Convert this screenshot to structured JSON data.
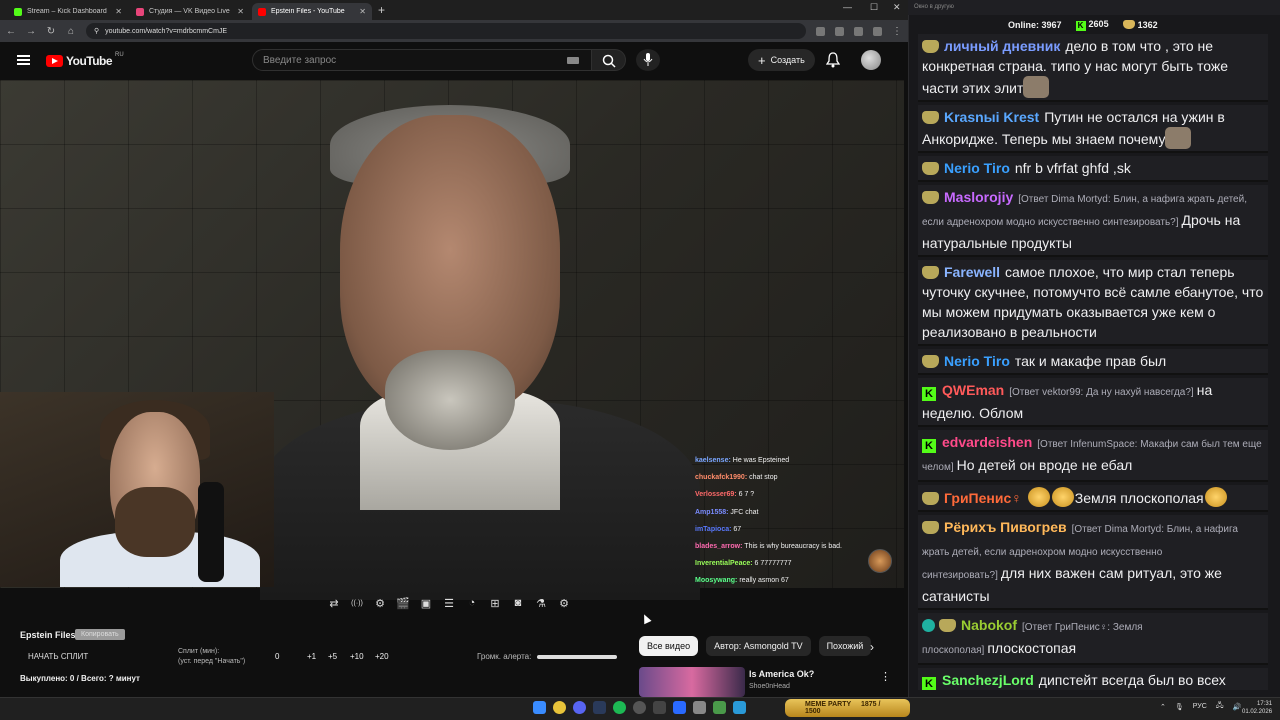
{
  "browser": {
    "tabs": [
      {
        "label": "Stream – Kick Dashboard",
        "color": "#53fc18"
      },
      {
        "label": "Студия — VK Видео Live",
        "color": "#e8457a"
      },
      {
        "label": "Epstein Files - YouTube",
        "color": "#ff0000"
      }
    ],
    "url": "youtube.com/watch?v=mdrbcmmCmJE"
  },
  "youtube": {
    "logo": "YouTube",
    "region": "RU",
    "search_placeholder": "Введите запрос",
    "create": "Создать"
  },
  "video_chat": [
    {
      "name": "kaelsense:",
      "text": "He was Epsteined",
      "color": "#7aa6ff"
    },
    {
      "name": "chuckafck1990:",
      "text": "chat stop",
      "color": "#ff8c6a"
    },
    {
      "name": "Verlosser69:",
      "text": "6 7 ?",
      "color": "#ff6a6a"
    },
    {
      "name": "Amp1558:",
      "text": "JFC chat",
      "color": "#7a8cff"
    },
    {
      "name": "imTapioca:",
      "text": "67",
      "color": "#5a7aff"
    },
    {
      "name": "blades_arrow:",
      "text": "This is why bureaucracy is bad.",
      "color": "#ff6ab0"
    },
    {
      "name": "InverentialPeace:",
      "text": "6 77777777",
      "color": "#9aff5a"
    },
    {
      "name": "Moosywang:",
      "text": "really asmon 67",
      "color": "#5aff8a"
    }
  ],
  "controls": {
    "icons": [
      "cycle-icon",
      "broadcast-icon",
      "webcam-settings-icon",
      "clapperboard-icon",
      "picture-icon",
      "split-icon",
      "speedometer-icon",
      "add-clip-icon",
      "camera-icon",
      "flask-icon",
      "gear-icon"
    ]
  },
  "below": {
    "title": "Epstein Files",
    "copy": "Копировать",
    "start_split": "НАЧАТЬ СПЛИТ",
    "split_label_1": "Сплит (мин):",
    "split_label_2": "(уст. перед \"Начать\")",
    "split_value": "0",
    "increments": [
      "+1",
      "+5",
      "+10",
      "+20"
    ],
    "bought": "Выкуплено: 0 / Всего: ? минут",
    "volume_label": "Громк. алерта:",
    "volume_level": 1.0
  },
  "chips": [
    "Все видео",
    "Автор: Asmongold TV",
    "Похожий"
  ],
  "recommendation": {
    "title": "Is America Ok?",
    "channel": "Shoe0nHead"
  },
  "chat": {
    "window_title": "Окно в другую",
    "online_label": "Online:",
    "online": "3967",
    "kick_count": "2605",
    "crown_count": "1362",
    "messages": [
      {
        "badge": "crown",
        "user": "личный дневник",
        "color": "#7a9cff",
        "reply": "",
        "text": "дело в том что , это не конкретная страна. типо у нас могут быть тоже части этих элит",
        "emote": "cat"
      },
      {
        "badge": "crown",
        "user": "Krasnыі Krest",
        "color": "#5aa8ff",
        "reply": "",
        "text": "Путин не остался на ужин в Анкоридже. Теперь мы знаем почему",
        "emote": "cat"
      },
      {
        "badge": "crown",
        "user": "Nerio Tiro",
        "color": "#3aa0ff",
        "reply": "",
        "text": "nfr b vfrfat ghfd ,sk",
        "emote": ""
      },
      {
        "badge": "crown",
        "user": "Maslorojiy",
        "color": "#c86aff",
        "reply": "[Ответ Dima Mortyd: Блин, а нафига жрать детей, если адренохром модно искусственно синтезировать?]",
        "text": "Дрочь на натуральные продукты",
        "emote": ""
      },
      {
        "badge": "crown",
        "user": "Farewell",
        "color": "#8ab4ff",
        "reply": "",
        "text": "самое плохое, что мир стал теперь чуточку скучнее, потомучто всё самле ебанутое, что мы можем придумать оказывается уже кем о реализовано в реальности",
        "emote": ""
      },
      {
        "badge": "crown",
        "user": "Nerio Tiro",
        "color": "#3aa0ff",
        "reply": "",
        "text": "так и макафе прав был",
        "emote": ""
      },
      {
        "badge": "kick",
        "user": "QWEman",
        "color": "#ff5a5a",
        "reply": "[Ответ vektor99: Да ну нахуй навсегда?]",
        "text": "на неделю. Облом",
        "emote": ""
      },
      {
        "badge": "kick",
        "user": "edvardeishen",
        "color": "#ff4a8a",
        "reply": "[Ответ InfenumSpace: Макафи сам был тем еще челом]",
        "text": "Но детей он вроде не ебал",
        "emote": ""
      },
      {
        "badge": "crown",
        "user": "ГриПенис♀",
        "color": "#ff6a3a",
        "reply": "",
        "text": "Земля плоскополая",
        "emote": "smile"
      },
      {
        "badge": "crown",
        "user": "Рёрихъ Пивогрев",
        "color": "#ffb85a",
        "reply": "[Ответ Dima Mortyd: Блин, а нафига жрать детей, если адренохром модно искусственно синтезировать?]",
        "text": "для них важен сам ритуал, это же сатанисты",
        "emote": ""
      },
      {
        "badge": "verified",
        "user": "Nabokof",
        "color": "#9acd32",
        "reply": "[Ответ ГриПенис♀: Земля плоскополая]",
        "text": "плоскостопая",
        "emote": ""
      },
      {
        "badge": "kick",
        "user": "SanchezjLord",
        "color": "#6aff6a",
        "reply": "",
        "text": "дипстейт всегда был во всех крупных государствах",
        "emote": ""
      }
    ]
  },
  "taskbar": {
    "meme_party": "MEME PARTY",
    "meme_progress": "1875 / 1500",
    "lang": "РУС",
    "time": "17:31",
    "date": "01.02.2026"
  }
}
